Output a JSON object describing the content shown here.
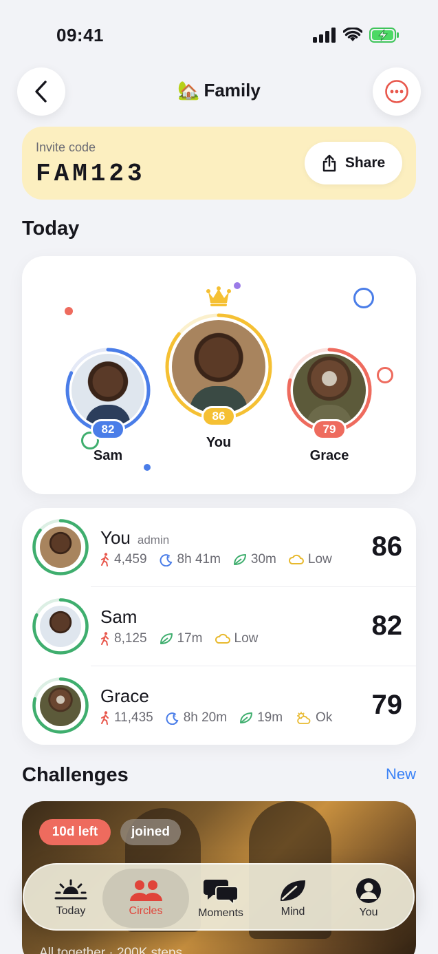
{
  "status_bar": {
    "time": "09:41"
  },
  "header": {
    "emoji": "🏡",
    "title": "Family"
  },
  "invite": {
    "label": "Invite code",
    "code": "FAM123",
    "share_label": "Share"
  },
  "today": {
    "title": "Today",
    "podium": [
      {
        "name": "Sam",
        "score": "82",
        "color": "#4a7de8",
        "progress": 0.82
      },
      {
        "name": "You",
        "score": "86",
        "color": "#f5c033",
        "progress": 0.86
      },
      {
        "name": "Grace",
        "score": "79",
        "color": "#ee6b5e",
        "progress": 0.79
      }
    ]
  },
  "members": [
    {
      "name": "You",
      "role": "admin",
      "score": "86",
      "steps": "4,459",
      "sleep": "8h 41m",
      "mindful": "30m",
      "weather": "Low"
    },
    {
      "name": "Sam",
      "role": "",
      "score": "82",
      "steps": "8,125",
      "mindful": "17m",
      "weather": "Low"
    },
    {
      "name": "Grace",
      "role": "",
      "score": "79",
      "steps": "11,435",
      "sleep": "8h 20m",
      "mindful": "19m",
      "weather": "Ok"
    }
  ],
  "challenges": {
    "title": "Challenges",
    "new_label": "New",
    "card": {
      "days_left": "10d left",
      "joined": "joined",
      "subtitle": "All together · 200K steps"
    }
  },
  "tabs": [
    {
      "label": "Today",
      "icon": "sunrise-icon"
    },
    {
      "label": "Circles",
      "icon": "people-icon",
      "active": true
    },
    {
      "label": "Moments",
      "icon": "chat-bubbles-icon"
    },
    {
      "label": "Mind",
      "icon": "leaf-icon"
    },
    {
      "label": "You",
      "icon": "person-icon"
    }
  ],
  "colors": {
    "accent_green": "#3fae6e",
    "accent_red": "#e0443a",
    "link_blue": "#3b82f6",
    "invite_bg": "#fcefc0"
  }
}
